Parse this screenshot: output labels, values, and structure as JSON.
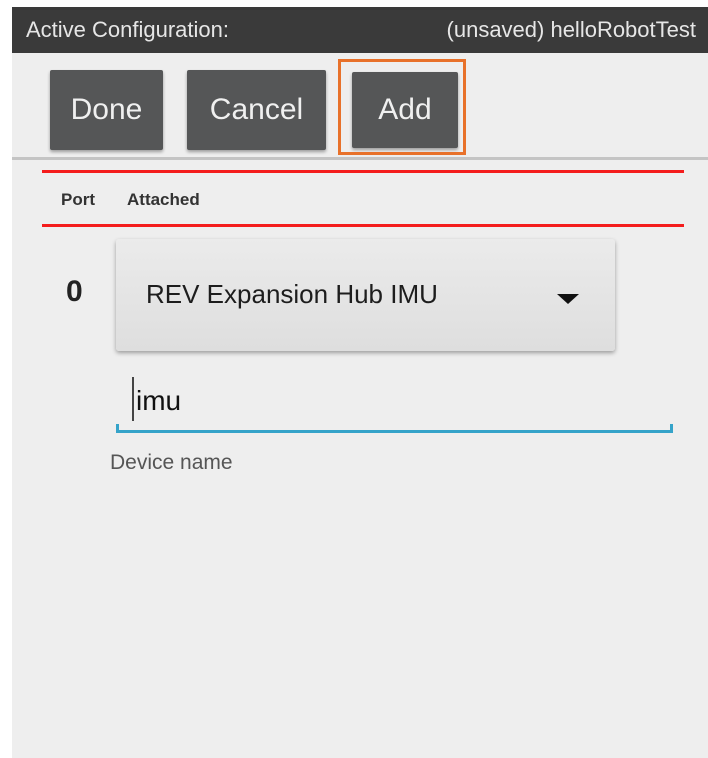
{
  "header": {
    "label": "Active Configuration:",
    "config_name": "(unsaved) helloRobotTest"
  },
  "toolbar": {
    "done_label": "Done",
    "cancel_label": "Cancel",
    "add_label": "Add"
  },
  "table": {
    "columns": [
      "Port",
      "Attached"
    ],
    "rows": [
      {
        "port": "0",
        "device": "REV Expansion Hub IMU",
        "name_value": "imu",
        "name_hint": "Device name"
      }
    ]
  },
  "colors": {
    "header_bg": "#3a3a3a",
    "content_bg": "#eeeeee",
    "button_bg": "#555657",
    "highlight_border": "#e8712a",
    "red_line": "#f41c1c",
    "input_underline": "#35a3c9"
  },
  "icons": {
    "dropdown": "dropdown-arrow-icon"
  }
}
